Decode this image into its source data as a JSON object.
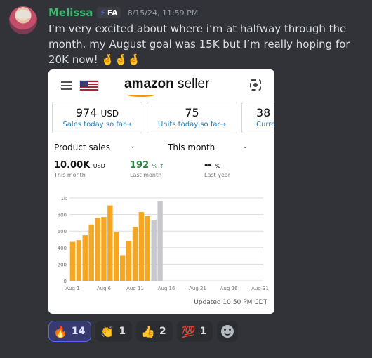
{
  "message": {
    "username": "Melissa",
    "tag_icon": "lightning-bolt-icon",
    "tag": "FA",
    "timestamp": "8/15/24, 11:59 PM",
    "text": "I’m very excited about where i’m at halfway through the month. my August goal was 15K but I’m really hoping for 20K now! 🤞🤞🤞",
    "username_color": "#3fb972"
  },
  "screenshot": {
    "logo": {
      "brand": "amazon",
      "suffix": " seller"
    },
    "stats": [
      {
        "value": "974",
        "unit": "USD",
        "link": "Sales today so far"
      },
      {
        "value": "75",
        "unit": "",
        "link": "Units today so far"
      },
      {
        "value": "38",
        "unit": "",
        "link": "Curre"
      }
    ],
    "selectors": {
      "left": "Product sales",
      "right": "This month"
    },
    "metrics": [
      {
        "value": "10.00K",
        "unit": "USD",
        "label": "This month"
      },
      {
        "value": "192",
        "unit": "% ↑",
        "label": "Last month"
      },
      {
        "value": "--",
        "unit": "%",
        "label": "Last year"
      }
    ],
    "updated": "Updated 10:50 PM CDT"
  },
  "chart_data": {
    "type": "bar",
    "y_ticks": [
      "1k",
      "800",
      "600",
      "400",
      "200",
      "0"
    ],
    "ylim": [
      0,
      1000
    ],
    "x_ticks": [
      {
        "label": "Aug 1",
        "day": 1
      },
      {
        "label": "Aug 6",
        "day": 6
      },
      {
        "label": "Aug 11",
        "day": 11
      },
      {
        "label": "Aug 16",
        "day": 16
      },
      {
        "label": "Aug 21",
        "day": 21
      },
      {
        "label": "Aug 26",
        "day": 26
      },
      {
        "label": "Aug 31",
        "day": 31
      }
    ],
    "days": [
      1,
      2,
      3,
      4,
      5,
      6,
      7,
      8,
      9,
      10,
      11,
      12,
      13,
      14,
      15
    ],
    "values": [
      470,
      490,
      550,
      680,
      760,
      770,
      910,
      590,
      310,
      480,
      650,
      830,
      780,
      730,
      960
    ],
    "status": [
      "complete",
      "complete",
      "complete",
      "complete",
      "complete",
      "complete",
      "complete",
      "complete",
      "complete",
      "complete",
      "complete",
      "complete",
      "complete",
      "partial",
      "partial"
    ],
    "colors": {
      "complete": "#f5a623",
      "partial": "#c8c8cc",
      "grid": "#dddddd"
    }
  },
  "reactions": [
    {
      "emoji": "🔥",
      "count": "14",
      "name": "fire-emoji",
      "active": true
    },
    {
      "emoji": "👏",
      "count": "1",
      "name": "clap-emoji",
      "active": false
    },
    {
      "emoji": "👍",
      "count": "2",
      "name": "thumbs-up-emoji",
      "active": false
    },
    {
      "emoji": "💯",
      "count": "1",
      "name": "hundred-emoji",
      "active": false
    }
  ]
}
